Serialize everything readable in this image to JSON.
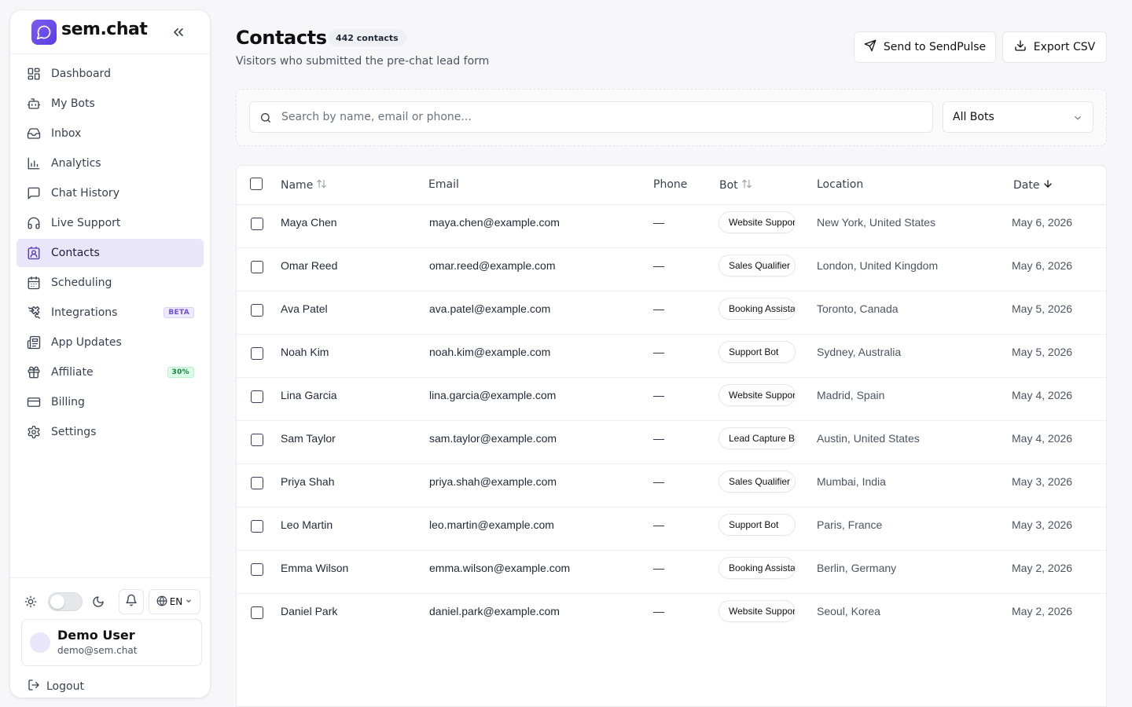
{
  "brand": {
    "name": "sem.chat"
  },
  "sidebar": {
    "items": [
      {
        "label": "Dashboard",
        "icon": "dashboard-icon"
      },
      {
        "label": "My Bots",
        "icon": "bot-icon"
      },
      {
        "label": "Inbox",
        "icon": "inbox-icon"
      },
      {
        "label": "Analytics",
        "icon": "bar-chart-icon"
      },
      {
        "label": "Chat History",
        "icon": "message-square-icon"
      },
      {
        "label": "Live Support",
        "icon": "headphones-icon"
      },
      {
        "label": "Contacts",
        "icon": "contact-card-icon",
        "active": true
      },
      {
        "label": "Scheduling",
        "icon": "calendar-icon"
      },
      {
        "label": "Integrations",
        "icon": "puzzle-icon",
        "badge": "BETA"
      },
      {
        "label": "App Updates",
        "icon": "newspaper-icon"
      },
      {
        "label": "Affiliate",
        "icon": "gift-icon",
        "badge": "30%"
      },
      {
        "label": "Billing",
        "icon": "credit-card-icon"
      },
      {
        "label": "Settings",
        "icon": "gear-icon"
      }
    ]
  },
  "footer": {
    "language": "EN",
    "user_name": "Demo User",
    "user_email": "demo@sem.chat",
    "logout_label": "Logout"
  },
  "header": {
    "title": "Contacts",
    "count": "442 contacts",
    "subtitle": "Visitors who submitted the pre-chat lead form",
    "send_label": "Send to SendPulse",
    "export_label": "Export CSV"
  },
  "filters": {
    "search_placeholder": "Search by name, email or phone...",
    "bot_filter": "All Bots"
  },
  "table": {
    "columns": {
      "name": "Name",
      "email": "Email",
      "phone": "Phone",
      "bot": "Bot",
      "location": "Location",
      "date": "Date"
    },
    "rows": [
      {
        "name": "Maya Chen",
        "email": "maya.chen@example.com",
        "phone": "—",
        "bot": "Website Support",
        "location": "New York, United States",
        "date": "May 6, 2026"
      },
      {
        "name": "Omar Reed",
        "email": "omar.reed@example.com",
        "phone": "—",
        "bot": "Sales Qualifier",
        "location": "London, United Kingdom",
        "date": "May 6, 2026"
      },
      {
        "name": "Ava Patel",
        "email": "ava.patel@example.com",
        "phone": "—",
        "bot": "Booking Assistant",
        "location": "Toronto, Canada",
        "date": "May 5, 2026"
      },
      {
        "name": "Noah Kim",
        "email": "noah.kim@example.com",
        "phone": "—",
        "bot": "Support Bot",
        "location": "Sydney, Australia",
        "date": "May 5, 2026"
      },
      {
        "name": "Lina Garcia",
        "email": "lina.garcia@example.com",
        "phone": "—",
        "bot": "Website Support",
        "location": "Madrid, Spain",
        "date": "May 4, 2026"
      },
      {
        "name": "Sam Taylor",
        "email": "sam.taylor@example.com",
        "phone": "—",
        "bot": "Lead Capture Bot",
        "location": "Austin, United States",
        "date": "May 4, 2026"
      },
      {
        "name": "Priya Shah",
        "email": "priya.shah@example.com",
        "phone": "—",
        "bot": "Sales Qualifier",
        "location": "Mumbai, India",
        "date": "May 3, 2026"
      },
      {
        "name": "Leo Martin",
        "email": "leo.martin@example.com",
        "phone": "—",
        "bot": "Support Bot",
        "location": "Paris, France",
        "date": "May 3, 2026"
      },
      {
        "name": "Emma Wilson",
        "email": "emma.wilson@example.com",
        "phone": "—",
        "bot": "Booking Assistant",
        "location": "Berlin, Germany",
        "date": "May 2, 2026"
      },
      {
        "name": "Daniel Park",
        "email": "daniel.park@example.com",
        "phone": "—",
        "bot": "Website Support",
        "location": "Seoul, Korea",
        "date": "May 2, 2026"
      }
    ]
  },
  "colors": {
    "accent": "#6d4fd8",
    "active_bg": "#e9e6fb"
  }
}
